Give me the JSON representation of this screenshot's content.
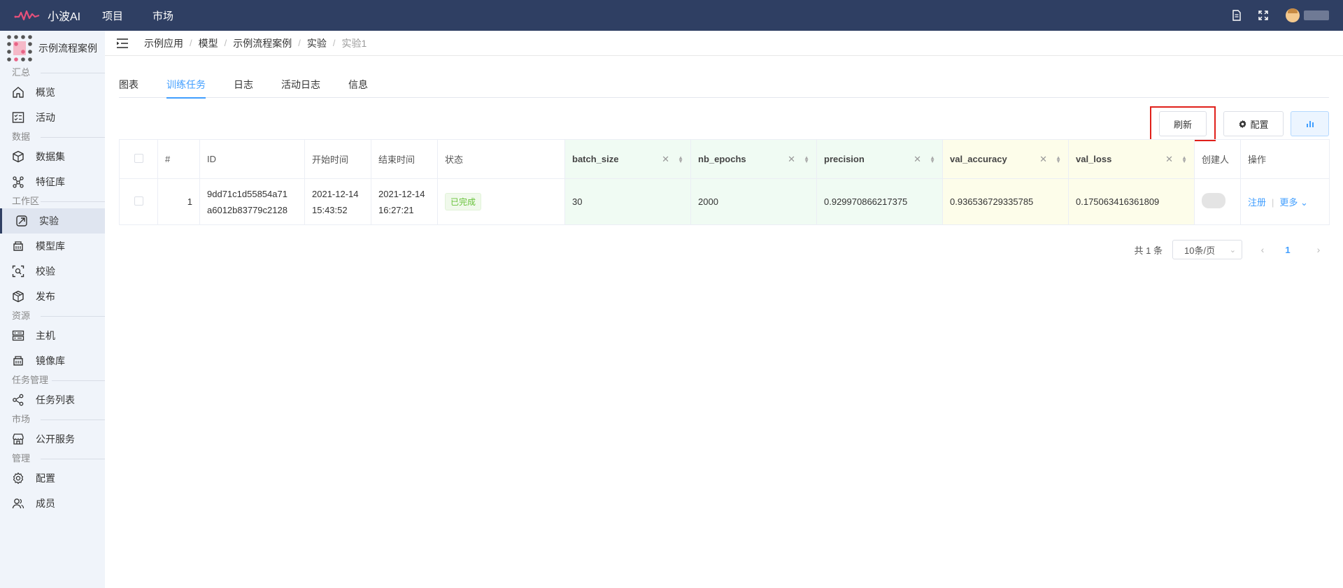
{
  "app": {
    "name": "小波AI"
  },
  "topnav": [
    "项目",
    "市场"
  ],
  "sidebar": {
    "project_name": "示例流程案例",
    "sections": {
      "summary": "汇总",
      "data": "数据",
      "workspace": "工作区",
      "resources": "资源",
      "tasks": "任务管理",
      "market": "市场",
      "admin": "管理"
    },
    "items": {
      "overview": "概览",
      "activity": "活动",
      "datasets": "数据集",
      "features": "特征库",
      "experiments": "实验",
      "models": "模型库",
      "validation": "校验",
      "publish": "发布",
      "hosts": "主机",
      "images": "镜像库",
      "tasklist": "任务列表",
      "public": "公开服务",
      "config": "配置",
      "members": "成员"
    }
  },
  "breadcrumb": [
    "示例应用",
    "模型",
    "示例流程案例",
    "实验",
    "实验1"
  ],
  "tabs": [
    "图表",
    "训练任务",
    "日志",
    "活动日志",
    "信息"
  ],
  "toolbar": {
    "refresh": "刷新",
    "config": "配置"
  },
  "table": {
    "headers": {
      "index": "#",
      "id": "ID",
      "start": "开始时间",
      "end": "结束时间",
      "status": "状态",
      "batch_size": "batch_size",
      "nb_epochs": "nb_epochs",
      "precision": "precision",
      "val_accuracy": "val_accuracy",
      "val_loss": "val_loss",
      "creator": "创建人",
      "ops": "操作"
    },
    "row": {
      "index": "1",
      "id_line1": "9dd71c1d55854a71",
      "id_line2": "a6012b83779c2128",
      "start_date": "2021-12-14",
      "start_time": "15:43:52",
      "end_date": "2021-12-14",
      "end_time": "16:27:21",
      "status": "已完成",
      "batch_size": "30",
      "nb_epochs": "2000",
      "precision": "0.929970866217375",
      "val_accuracy": "0.936536729335785",
      "val_loss": "0.175063416361809",
      "op_register": "注册",
      "op_more": "更多"
    }
  },
  "pagination": {
    "total": "共 1 条",
    "page_size": "10条/页",
    "current": "1"
  },
  "colors": {
    "topbar": "#2f3f63",
    "accent": "#409eff",
    "sidebar": "#f0f4fa",
    "highlight": "#e0201a"
  }
}
